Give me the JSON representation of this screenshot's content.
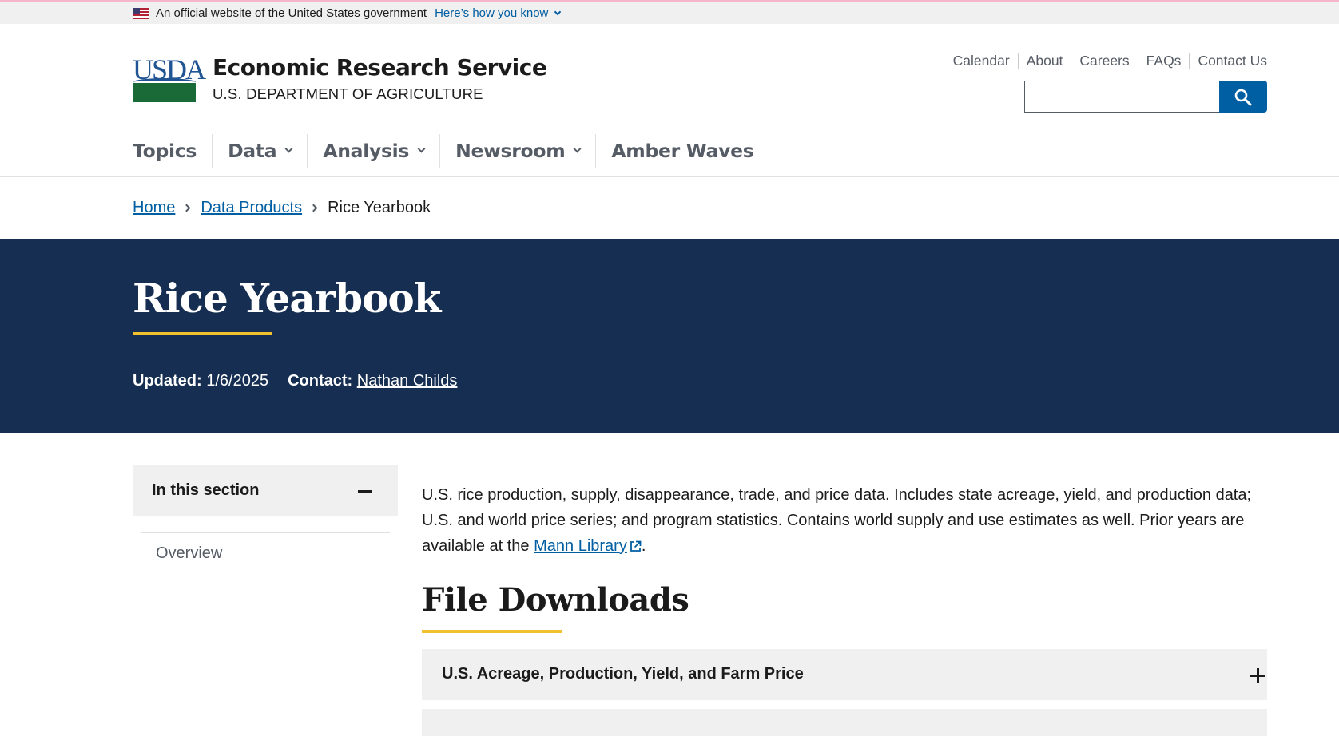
{
  "gov_banner": {
    "text": "An official website of the United States government",
    "link": "Here’s how you know"
  },
  "header": {
    "logo_text": "USDA",
    "site_name": "Economic Research Service",
    "site_subtitle": "U.S. DEPARTMENT OF AGRICULTURE",
    "utility_links": [
      "Calendar",
      "About",
      "Careers",
      "FAQs",
      "Contact Us"
    ],
    "search": {
      "value": "",
      "placeholder": ""
    }
  },
  "main_nav": [
    {
      "label": "Topics",
      "has_dropdown": false
    },
    {
      "label": "Data",
      "has_dropdown": true
    },
    {
      "label": "Analysis",
      "has_dropdown": true
    },
    {
      "label": "Newsroom",
      "has_dropdown": true
    },
    {
      "label": "Amber Waves",
      "has_dropdown": false
    }
  ],
  "breadcrumb": {
    "items": [
      "Home",
      "Data Products"
    ],
    "current": "Rice Yearbook"
  },
  "hero": {
    "title": "Rice Yearbook",
    "updated_label": "Updated:",
    "updated_value": "1/6/2025",
    "contact_label": "Contact:",
    "contact_value": "Nathan Childs"
  },
  "sidebar": {
    "heading": "In this section",
    "items": [
      "Overview"
    ]
  },
  "content": {
    "intro_before": "U.S. rice production, supply, disappearance, trade, and price data. Includes state acreage, yield, and production data; U.S. and world price series; and program statistics. Contains world supply and use estimates as well. Prior years are available at the ",
    "intro_link": "Mann Library",
    "intro_after": ".",
    "downloads_title": "File Downloads",
    "accordion": [
      {
        "label": "U.S. Acreage, Production, Yield, and Farm Price"
      },
      {
        "label": ""
      }
    ]
  },
  "colors": {
    "link": "#005ea2",
    "hero_bg": "#162e51",
    "accent_gold": "#f2c12e",
    "panel_gray": "#f0f0f0"
  },
  "icons": [
    "flag-icon",
    "chevron-down-icon",
    "search-icon",
    "chevron-right-icon",
    "minus-icon",
    "external-link-icon",
    "plus-icon"
  ]
}
